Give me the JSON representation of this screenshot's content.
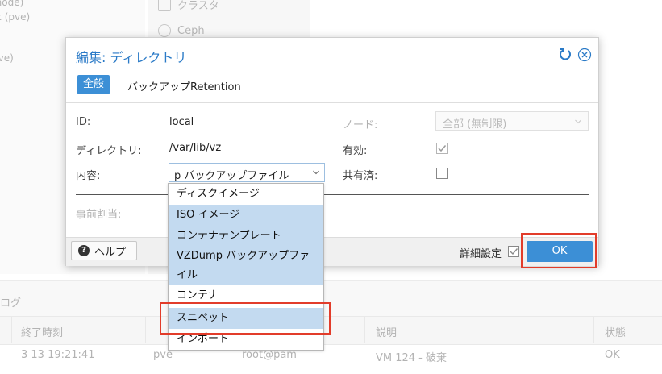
{
  "background": {
    "tree": [
      "(node)",
      "rk (pve)",
      ")",
      "pve)"
    ],
    "nav": [
      "クラスタ",
      "Ceph"
    ],
    "log_title": "ログ",
    "columns": [
      "終了時刻",
      "",
      "",
      "説明",
      "状態"
    ],
    "row": [
      "3 13 19:21:41",
      "pve",
      "root@pam",
      "VM 124 - 破棄",
      "OK"
    ]
  },
  "dialog": {
    "title": "編集: ディレクトリ",
    "tabs": [
      "全般",
      "バックアップRetention"
    ],
    "fields": {
      "id_label": "ID:",
      "id_value": "local",
      "dir_label": "ディレクトリ:",
      "dir_value": "/var/lib/vz",
      "content_label": "内容:",
      "content_value": "p バックアップファイル",
      "prealloc_label": "事前割当:",
      "node_label": "ノード:",
      "node_value": "全部 (無制限)",
      "enabled_label": "有効:",
      "enabled": true,
      "shared_label": "共有済:",
      "shared": false
    },
    "footer": {
      "help": "ヘルプ",
      "advanced": "詳細設定",
      "ok": "OK"
    },
    "content_options": [
      {
        "label": "ディスクイメージ",
        "selected": false
      },
      {
        "label": "ISO イメージ",
        "selected": true
      },
      {
        "label": "コンテナテンプレート",
        "selected": true
      },
      {
        "label": "VZDump バックアップファ",
        "selected": true
      },
      {
        "label": "イル",
        "selected": true
      },
      {
        "label": "コンテナ",
        "selected": false
      },
      {
        "label": "スニペット",
        "selected": true
      },
      {
        "label": "インポート",
        "selected": false
      }
    ]
  },
  "colors": {
    "accent": "#3c8fd6",
    "title": "#2a7ac7",
    "selection": "#c3daf0",
    "highlight": "#e23c2a"
  }
}
